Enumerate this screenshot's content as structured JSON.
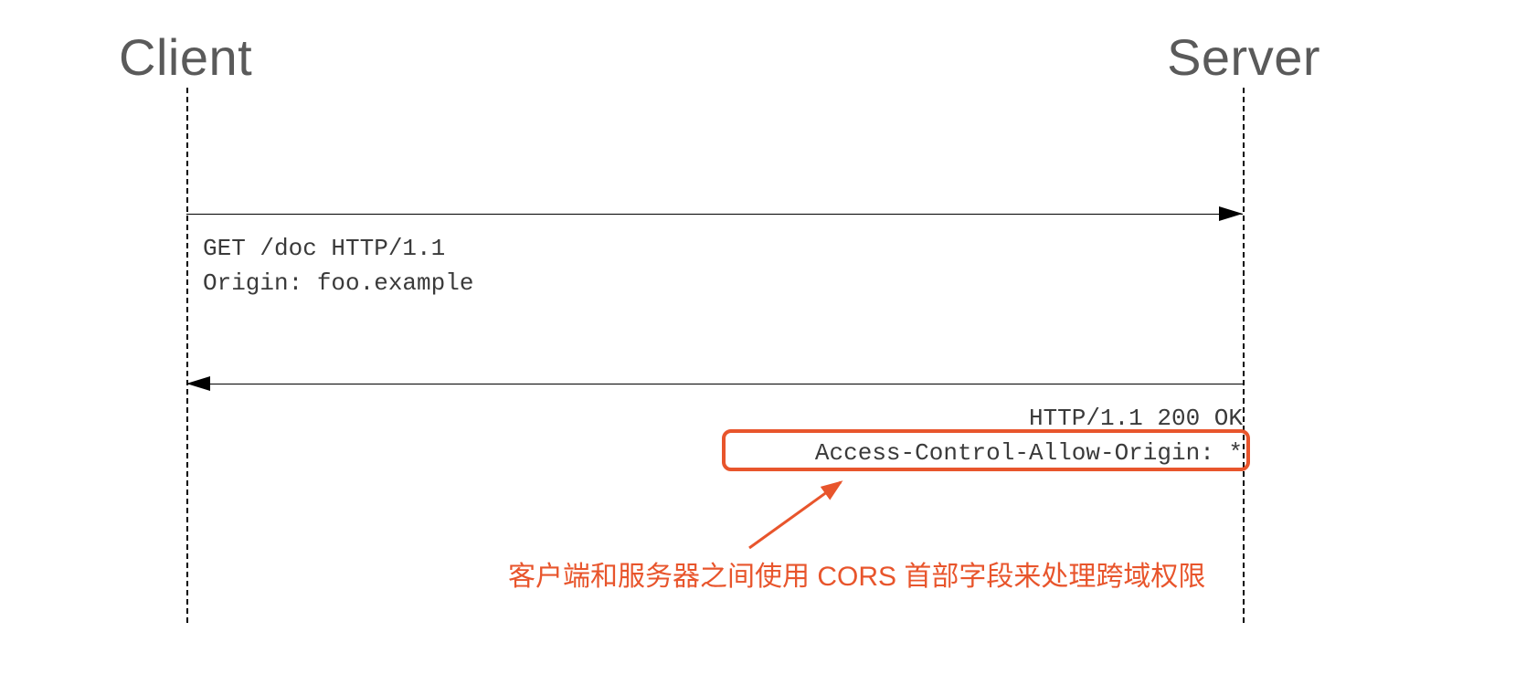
{
  "labels": {
    "client": "Client",
    "server": "Server"
  },
  "request": {
    "line1": "GET /doc HTTP/1.1",
    "line2": "Origin: foo.example"
  },
  "response": {
    "line1": "HTTP/1.1 200 OK",
    "line2": "Access-Control-Allow-Origin: *"
  },
  "annotation": {
    "text": "客户端和服务器之间使用 CORS 首部字段来处理跨域权限"
  },
  "colors": {
    "accent": "#e8552c",
    "text": "#5a5a5a",
    "mono": "#3a3a3a"
  }
}
